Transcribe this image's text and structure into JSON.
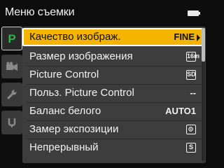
{
  "header": {
    "title": "Меню съемки",
    "battery_icon": "battery-full-icon"
  },
  "tabs": [
    {
      "name": "shooting-menu",
      "letter": "P",
      "icon": "shooting-mode-icon",
      "active": true
    },
    {
      "name": "movie-menu",
      "icon": "movie-camera-icon",
      "active": false
    },
    {
      "name": "setup-menu",
      "icon": "wrench-icon",
      "active": false
    },
    {
      "name": "custom-menu",
      "icon": "pencil-icon",
      "active": false
    }
  ],
  "menu": {
    "items": [
      {
        "label": "Качество изображ.",
        "value": "FINE",
        "selected": true
      },
      {
        "label": "Размер изображения",
        "value": "16m",
        "value_icon": "image-size-icon"
      },
      {
        "label": "Picture Control",
        "value": "SD",
        "value_icon": "picture-control-standard-icon"
      },
      {
        "label": "Польз. Picture Control",
        "value": "--"
      },
      {
        "label": "Баланс белого",
        "value": "AUTO1"
      },
      {
        "label": "Замер экспозиции",
        "value": "",
        "value_icon": "matrix-metering-icon"
      },
      {
        "label": "Непрерывный",
        "value": "S",
        "value_icon": "single-frame-icon"
      }
    ]
  },
  "colors": {
    "selection": "#f4b400",
    "panel": "#3d3d3d",
    "background": "#0d0d0d",
    "active_tab_letter": "#2fb34a"
  },
  "scroll": {
    "position_fraction": 0.0,
    "visible_fraction": 0.25
  }
}
